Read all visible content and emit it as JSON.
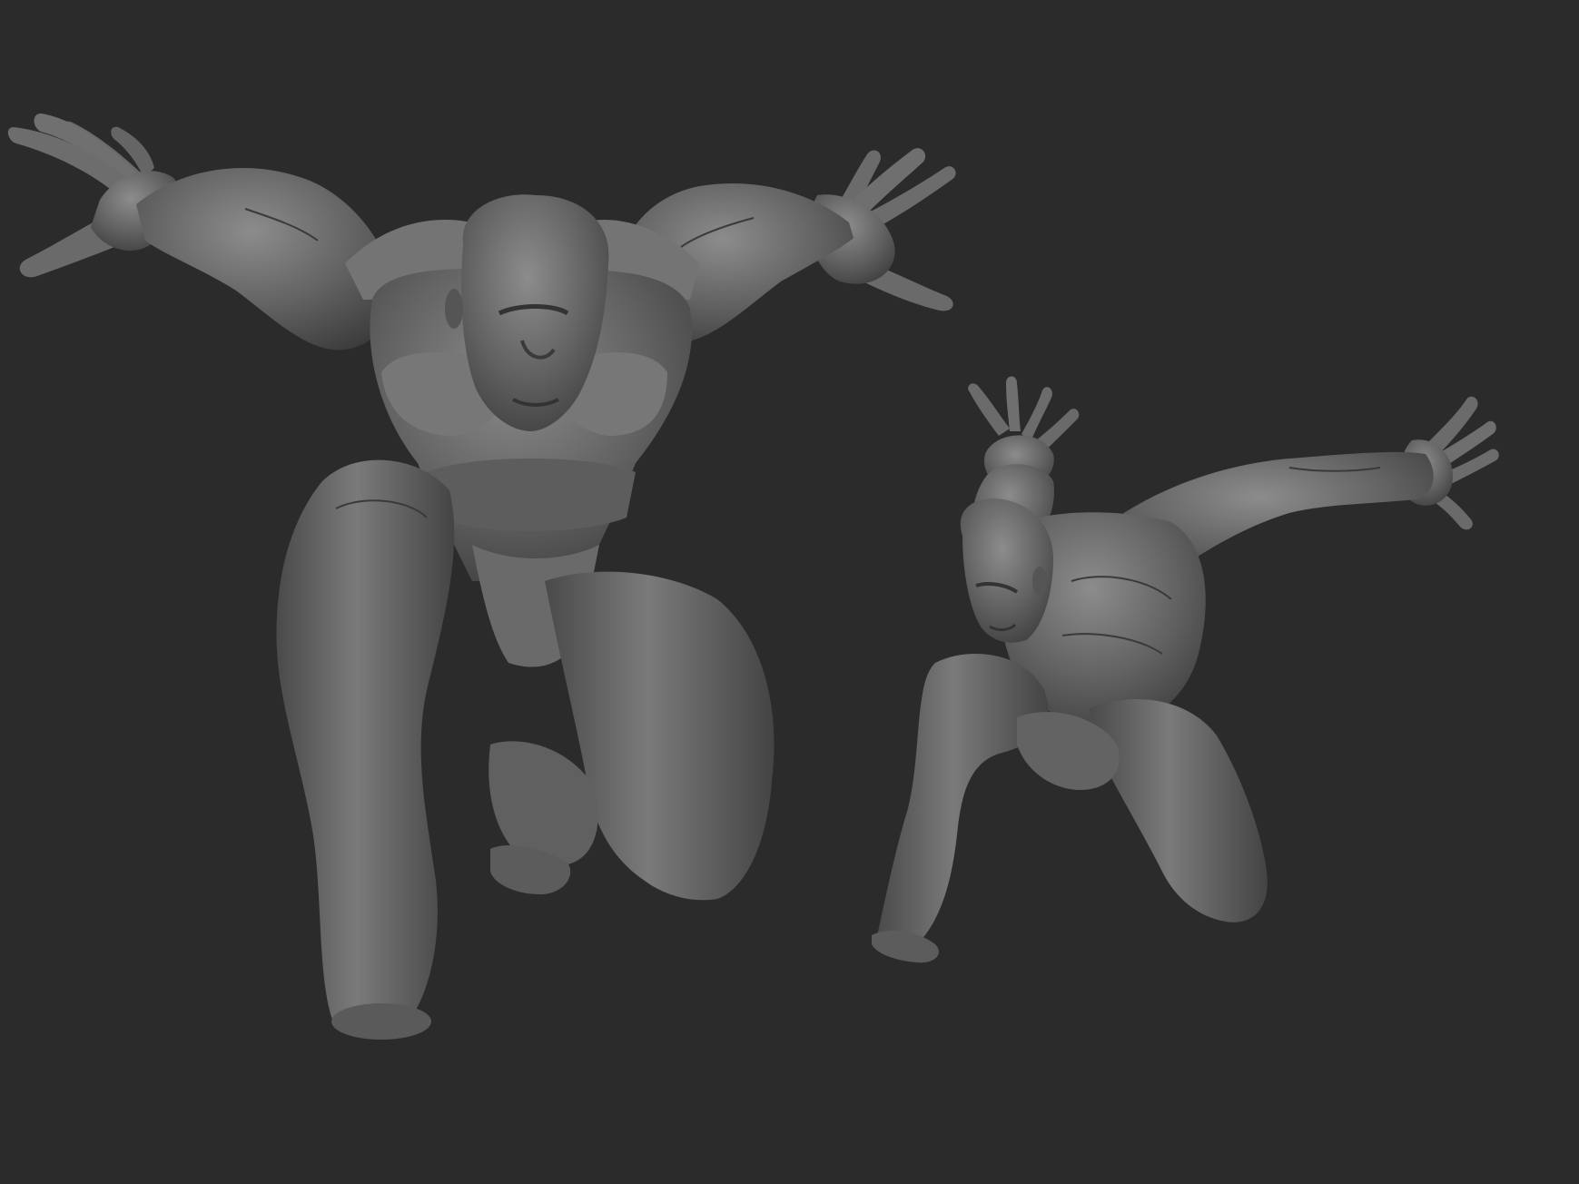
{
  "scene": {
    "background_color": "#2b2b2b",
    "material_color": "#6b6b6b",
    "figures": [
      {
        "name": "front-view-crouching-figure"
      },
      {
        "name": "side-view-crouching-figure"
      }
    ]
  }
}
